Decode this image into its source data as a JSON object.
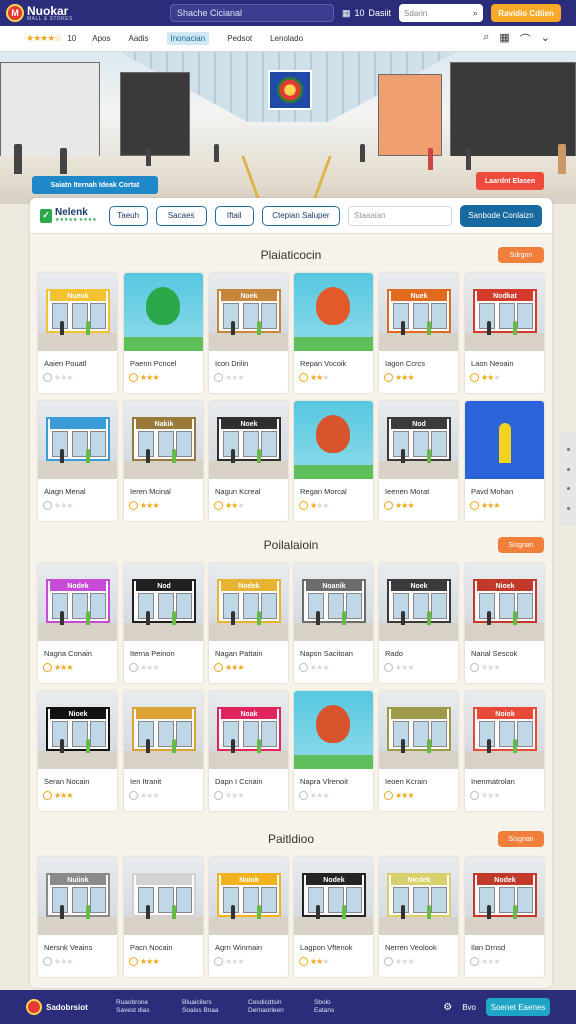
{
  "topbar": {
    "logo_mark": "M",
    "logo_name": "Nuokar",
    "logo_sub": "MALL & STORES",
    "search_text": "Shache Cicianal",
    "mid_icon": "grid-icon",
    "mid_num": "10",
    "mid_text": "Dasiit",
    "search2_placeholder": "Sdarin",
    "cta": "Ravidio Cdiien"
  },
  "nav": {
    "rating_num": "10",
    "stars": "★★★★☆",
    "items": [
      "Apos",
      "Aadis",
      "Inonacian",
      "Pedsot",
      "Lenolado"
    ],
    "active_index": 2
  },
  "hero": {
    "tag_left": "Saiatn Iternah Ideak Cortat",
    "tag_right": "Laardnt Elasen"
  },
  "filters": {
    "brand_name": "Nelenk",
    "brand_sub": "★★★★★ ★★★★",
    "pills": [
      "Taeuh",
      "Sacaes",
      "Iftail",
      "Ctepian Saluper"
    ],
    "input_placeholder": "Staaaian",
    "button": "Sanbode Conlaizn"
  },
  "sections": [
    {
      "title": "Plaiaticocin",
      "button": "Sdrgnn"
    },
    {
      "title": "Poilalaioin",
      "button": "Sisgnan"
    },
    {
      "title": "Paitldioo",
      "button": "Sisgnan"
    }
  ],
  "cards": [
    {
      "name": "Aaien Pouatl",
      "stars": 0,
      "theme": "store",
      "sign": "Nueuk",
      "color": "#f2c230"
    },
    {
      "name": "Paenn Pcncel",
      "stars": 3,
      "theme": "balloon",
      "sign": "",
      "color": "#2aa84a"
    },
    {
      "name": "Icon Drilin",
      "stars": 0,
      "theme": "store",
      "sign": "Noek",
      "color": "#c8863c"
    },
    {
      "name": "Repan Vocoik",
      "stars": 2,
      "theme": "balloon",
      "sign": "",
      "color": "#e25a2a"
    },
    {
      "name": "Iagon Ccrcs",
      "stars": 3,
      "theme": "store",
      "sign": "Nuek",
      "color": "#e06a1e"
    },
    {
      "name": "Laon Neoain",
      "stars": 2,
      "theme": "store",
      "sign": "Nodkat",
      "color": "#d23b2c"
    },
    {
      "name": "Aiagn Menal",
      "stars": 0,
      "theme": "store",
      "sign": "",
      "color": "#3a9bd8"
    },
    {
      "name": "Ieren Mcinal",
      "stars": 3,
      "theme": "store",
      "sign": "Nakik",
      "color": "#9a7a3a"
    },
    {
      "name": "Nagun Kcreal",
      "stars": 2,
      "theme": "store",
      "sign": "Noek",
      "color": "#2f2f2f"
    },
    {
      "name": "Regan Morcal",
      "stars": 1,
      "theme": "balloon",
      "sign": "",
      "color": "#d8542c"
    },
    {
      "name": "Ieenen Morat",
      "stars": 3,
      "theme": "store",
      "sign": "Nod",
      "color": "#3b3b3b"
    },
    {
      "name": "Pavd Mohan",
      "stars": 3,
      "theme": "person",
      "sign": "",
      "color": "#2c6fd6"
    },
    {
      "name": "Nagna Conain",
      "stars": 3,
      "theme": "store",
      "sign": "Nodek",
      "color": "#c84bd8"
    },
    {
      "name": "Iterna Peinon",
      "stars": 0,
      "theme": "store",
      "sign": "Nod",
      "color": "#202020"
    },
    {
      "name": "Nagan Pattain",
      "stars": 3,
      "theme": "store",
      "sign": "Nodek",
      "color": "#e8b232"
    },
    {
      "name": "Napsn Sacitoan",
      "stars": 0,
      "theme": "store",
      "sign": "Noanik",
      "color": "#6c6c6c"
    },
    {
      "name": "Rado",
      "stars": 0,
      "theme": "store",
      "sign": "Noek",
      "color": "#3a3a3a"
    },
    {
      "name": "Nanal Sescok",
      "stars": 0,
      "theme": "store",
      "sign": "Nioek",
      "color": "#c0392b"
    },
    {
      "name": "Seran Nocain",
      "stars": 3,
      "theme": "store",
      "sign": "Nioek",
      "color": "#111111"
    },
    {
      "name": "Ien Itranit",
      "stars": 0,
      "theme": "store",
      "sign": "",
      "color": "#d9a233"
    },
    {
      "name": "Dapn I Ccnain",
      "stars": 0,
      "theme": "store",
      "sign": "Noak",
      "color": "#e0245e"
    },
    {
      "name": "Napra Vlrenoit",
      "stars": 0,
      "theme": "balloon",
      "sign": "",
      "color": "#d8542c"
    },
    {
      "name": "Ieoen Kcrain",
      "stars": 3,
      "theme": "store",
      "sign": "",
      "color": "#9f9a4a"
    },
    {
      "name": "Inenmatrolan",
      "stars": 0,
      "theme": "store",
      "sign": "Noiok",
      "color": "#e84a3a"
    },
    {
      "name": "Nersnk Veains",
      "stars": 0,
      "theme": "store",
      "sign": "Nuiiok",
      "color": "#8a8a8a"
    },
    {
      "name": "Pacn Nocain",
      "stars": 3,
      "theme": "store",
      "sign": "",
      "color": "#d2d2d2"
    },
    {
      "name": "Agrn Winmain",
      "stars": 0,
      "theme": "store",
      "sign": "Noiok",
      "color": "#f2b21e"
    },
    {
      "name": "Lagpon Vftenok",
      "stars": 2,
      "theme": "store",
      "sign": "Nodek",
      "color": "#242424"
    },
    {
      "name": "Nerren Veolook",
      "stars": 0,
      "theme": "store",
      "sign": "Nicdek",
      "color": "#d8d06a"
    },
    {
      "name": "Ilan Drnsd",
      "stars": 0,
      "theme": "store",
      "sign": "Nodek",
      "color": "#c0392b"
    }
  ],
  "footer": {
    "logo_name": "Sadobrsiot",
    "cols": [
      [
        "Ruaobrone",
        "Savest dias"
      ],
      [
        "Bluaicilers",
        "Soaiss Bnaa"
      ],
      [
        "Cesdicdtsin",
        "Dernaorleen"
      ],
      [
        "Sbolo",
        "Eatans"
      ]
    ],
    "lang": "Bvo",
    "button": "Soenet Eaenes"
  }
}
